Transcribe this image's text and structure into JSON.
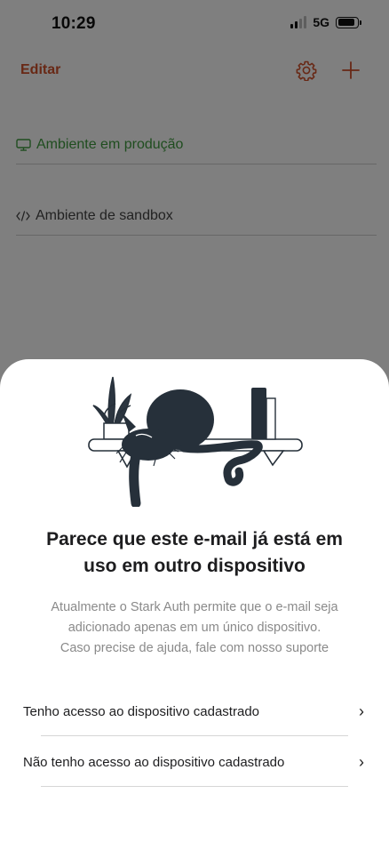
{
  "status_bar": {
    "time": "10:29",
    "network": "5G"
  },
  "nav": {
    "edit_label": "Editar"
  },
  "environments": [
    {
      "label": "Ambiente em produção",
      "color": "#3f9a3f"
    },
    {
      "label": "Ambiente de sandbox",
      "color": "#444444"
    }
  ],
  "sheet": {
    "title_line1": "Parece que este e-mail já está em",
    "title_line2": "uso em outro dispositivo",
    "desc_line1": "Atualmente o Stark Auth permite que o e-mail seja",
    "desc_line2": "adicionado apenas em um único dispositivo.",
    "desc_line3": "Caso precise de ajuda, fale com nosso suporte",
    "options": [
      {
        "label": "Tenho acesso ao dispositivo cadastrado"
      },
      {
        "label": "Não tenho acesso ao dispositivo cadastrado"
      }
    ]
  },
  "colors": {
    "accent": "#d0502a",
    "production": "#3f9a3f",
    "sheet_bg": "#ffffff"
  }
}
